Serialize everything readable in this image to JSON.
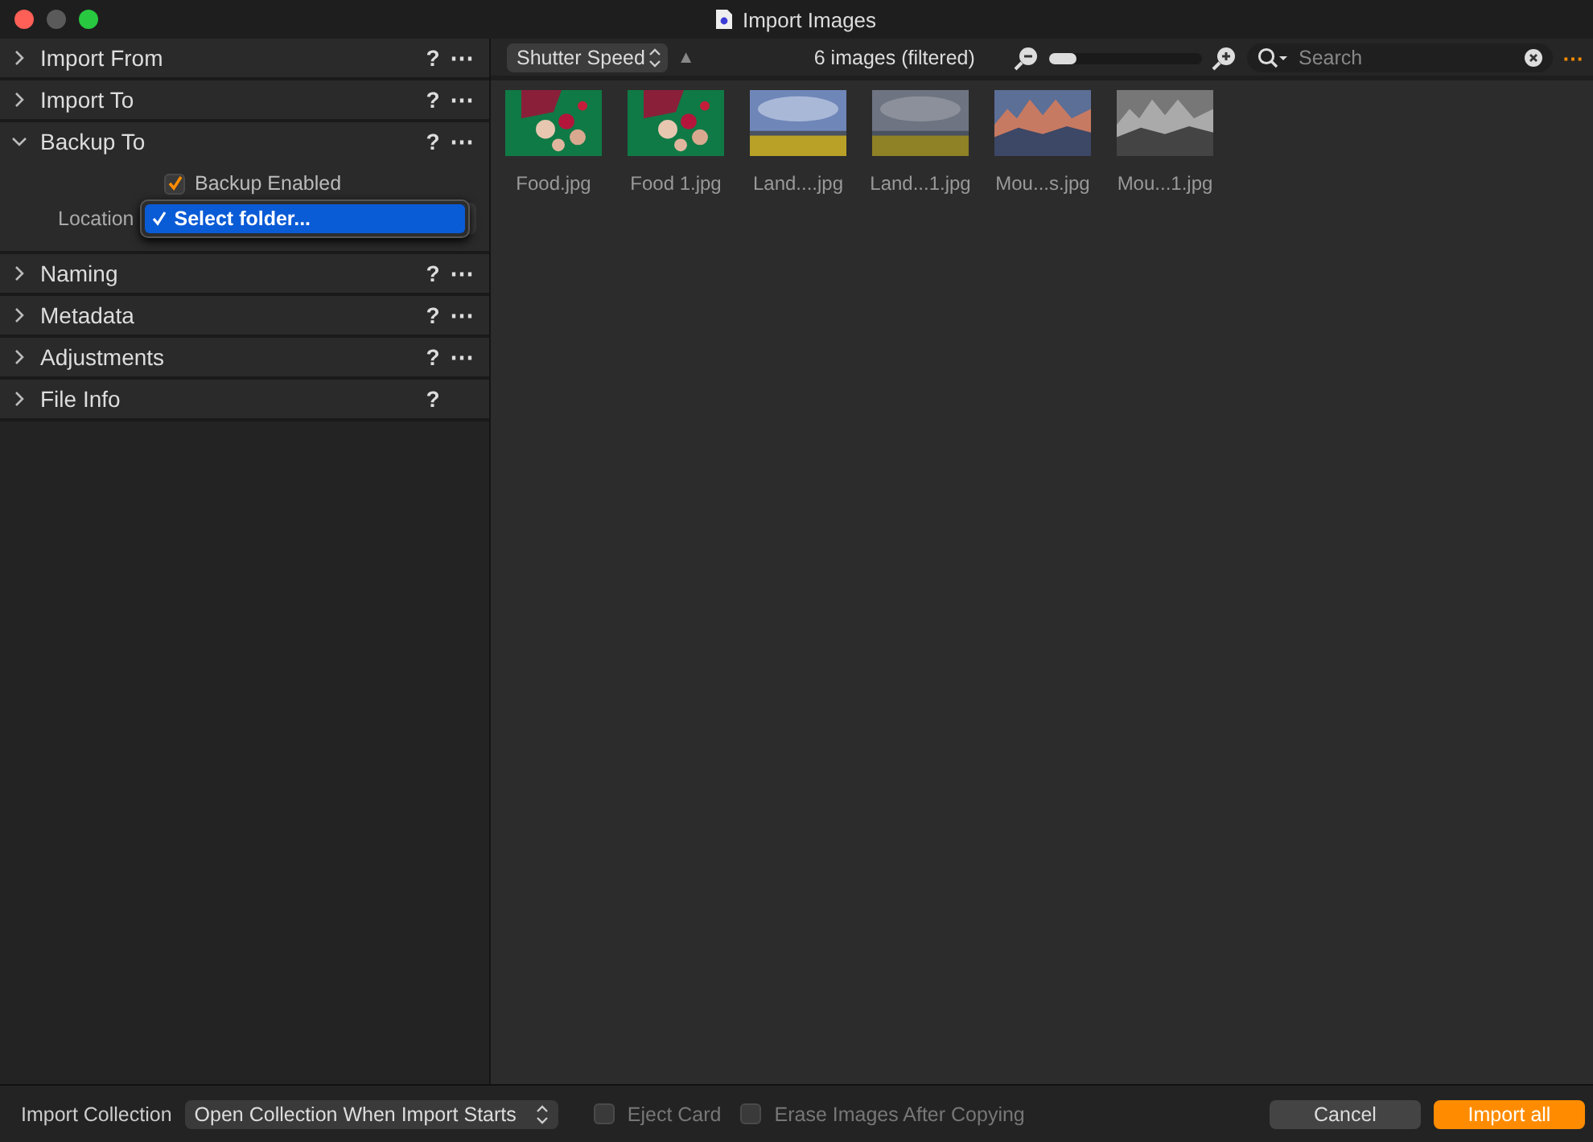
{
  "window": {
    "title": "Import Images"
  },
  "sections": [
    {
      "title": "Import From",
      "expanded": false,
      "help": "?",
      "more": "⋯"
    },
    {
      "title": "Import To",
      "expanded": false,
      "help": "?",
      "more": "⋯"
    },
    {
      "title": "Backup To",
      "expanded": true,
      "help": "?",
      "more": "⋯"
    },
    {
      "title": "Naming",
      "expanded": false,
      "help": "?",
      "more": "⋯"
    },
    {
      "title": "Metadata",
      "expanded": false,
      "help": "?",
      "more": "⋯"
    },
    {
      "title": "Adjustments",
      "expanded": false,
      "help": "?",
      "more": "⋯"
    },
    {
      "title": "File Info",
      "expanded": false,
      "help": "?"
    }
  ],
  "backup": {
    "enabled_label": "Backup Enabled",
    "enabled": true,
    "location_label": "Location",
    "menu_items": [
      {
        "label": "Select folder...",
        "checked": true,
        "selected": true
      }
    ]
  },
  "toolbar": {
    "sort": "Shutter Speed",
    "sort_arrow": "▲",
    "count": "6 images (filtered)",
    "zoom": {
      "level": 0.18
    },
    "search_placeholder": "Search",
    "more": "⋯"
  },
  "images": [
    {
      "name": "Food.jpg"
    },
    {
      "name": "Food 1.jpg"
    },
    {
      "name": "Land....jpg"
    },
    {
      "name": "Land...1.jpg"
    },
    {
      "name": "Mou...s.jpg"
    },
    {
      "name": "Mou...1.jpg"
    }
  ],
  "footer": {
    "collection_label": "Import Collection",
    "collection_value": "Open Collection When Import Starts",
    "options": [
      {
        "label": "Eject Card",
        "checked": false
      },
      {
        "label": "Erase Images After Copying",
        "checked": false
      }
    ],
    "cancel": "Cancel",
    "import": "Import all"
  }
}
